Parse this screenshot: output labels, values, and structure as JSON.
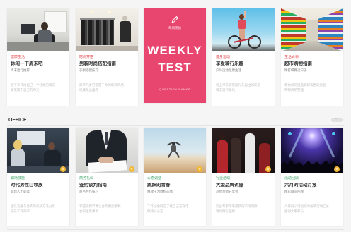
{
  "colors": {
    "background": "#f5f5f5",
    "card": "#ffffff",
    "weekly_pink": "#e8456f",
    "label_red": "#e5484d",
    "label_green": "#3fa66a",
    "badge_yellow": "#f2b631"
  },
  "top_cards": [
    {
      "image": "office-desk-photo",
      "label": "健康生活",
      "title": "休闲一下周末吧",
      "subtitle": "周末出行推荐",
      "desc1": "放下工作给自己一个轻松的周末",
      "desc2": "享受属于自己的时光"
    },
    {
      "image": "clothing-rack-photo",
      "label": "时尚穿搭",
      "title": "男装时尚搭配指南",
      "subtitle": "衣橱搭配技巧",
      "desc1": "简单几步打造属于你的职场风格",
      "desc2": "经典单品推荐"
    },
    {
      "image": "cycling-woman-photo",
      "label": "健身运动",
      "title": "享受骑行乐趣",
      "subtitle": "户外运动健康生活",
      "desc1": "骑上单车感受阳光与自由的味道",
      "desc2": "周末骑行路线"
    },
    {
      "image": "supermarket-aisle-photo",
      "label": "生活百科",
      "title": "超市购物指南",
      "subtitle": "精打细算过日子",
      "desc1": "教你如何挑选新鲜实惠的商品",
      "desc2": "购物清单整理"
    }
  ],
  "weekly_card": {
    "icon": "pencil-icon",
    "tag": "每周测验",
    "line1": "WEEKLY",
    "line2": "TEST",
    "footer": "QUESTION BANKS"
  },
  "section": {
    "title": "OFFICE",
    "more_icon": "more-icon",
    "more_glyph": "···"
  },
  "office_cards": [
    {
      "image": "office-meeting-photo",
      "label": "职场技能",
      "title": "时代男性白领族",
      "subtitle": "职场人士必读",
      "desc1": "团队沟通与协作的高效方法分享",
      "desc2": "提升工作效率",
      "badge": "★"
    },
    {
      "image": "contract-signing-photo",
      "label": "商务礼仪",
      "title": "签约谈判指南",
      "subtitle": "商务合作技巧",
      "desc1": "掌握谈判节奏让合作更加顺利",
      "desc2": "合同注意事项",
      "badge": "★"
    },
    {
      "image": "jumping-field-photo",
      "label": "心态调整",
      "title": "跳跃的青春",
      "subtitle": "释放压力放松心情",
      "desc1": "工作之余别忘了给自己充充电",
      "desc2": "保持好心态",
      "badge": "★"
    },
    {
      "image": "event-lecture-photo",
      "label": "行业活动",
      "title": "大型品牌讲座",
      "subtitle": "品牌营销分享会",
      "desc1": "行业专家带来最新的市场洞察",
      "desc2": "现场精彩回顾",
      "badge": "★"
    },
    {
      "image": "concert-crowd-photo",
      "label": "活动回顾",
      "title": "六月的活动月报",
      "subtitle": "精彩瞬间回顾",
      "desc1": "六月份公司组织的各项活动汇总",
      "desc2": "感谢大家参与",
      "badge": "★"
    }
  ]
}
